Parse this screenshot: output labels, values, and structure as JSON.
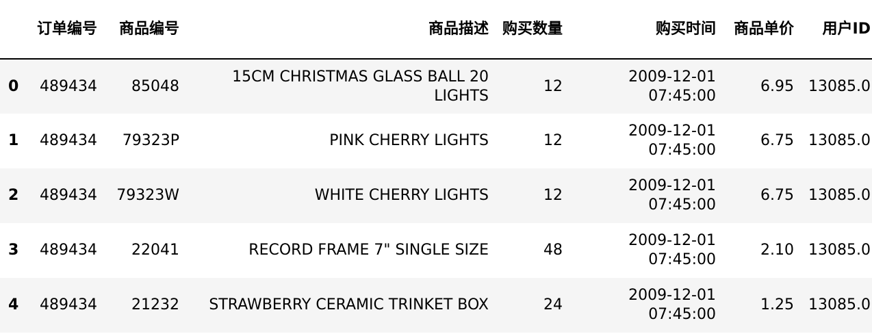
{
  "table": {
    "columns": [
      "订单编号",
      "商品编号",
      "商品描述",
      "购买数量",
      "购买时间",
      "商品单价",
      "用户ID"
    ],
    "rows": [
      {
        "index": "0",
        "cells": [
          "489434",
          "85048",
          "15CM CHRISTMAS GLASS BALL 20 LIGHTS",
          "12",
          "2009-12-01 07:45:00",
          "6.95",
          "13085.0"
        ]
      },
      {
        "index": "1",
        "cells": [
          "489434",
          "79323P",
          "PINK CHERRY LIGHTS",
          "12",
          "2009-12-01 07:45:00",
          "6.75",
          "13085.0"
        ]
      },
      {
        "index": "2",
        "cells": [
          "489434",
          "79323W",
          "WHITE CHERRY LIGHTS",
          "12",
          "2009-12-01 07:45:00",
          "6.75",
          "13085.0"
        ]
      },
      {
        "index": "3",
        "cells": [
          "489434",
          "22041",
          "RECORD FRAME 7\" SINGLE SIZE",
          "48",
          "2009-12-01 07:45:00",
          "2.10",
          "13085.0"
        ]
      },
      {
        "index": "4",
        "cells": [
          "489434",
          "21232",
          "STRAWBERRY CERAMIC TRINKET BOX",
          "24",
          "2009-12-01 07:45:00",
          "1.25",
          "13085.0"
        ]
      }
    ]
  }
}
